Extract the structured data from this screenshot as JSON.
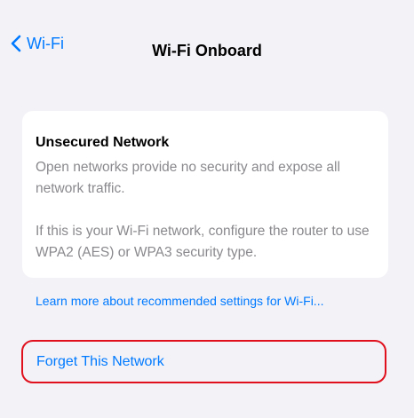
{
  "nav": {
    "back_label": "Wi-Fi",
    "title": "Wi-Fi Onboard"
  },
  "card": {
    "title": "Unsecured Network",
    "body_1": "Open networks provide no security and expose all network traffic.",
    "body_2": "If this is your Wi-Fi network, configure the router to use WPA2 (AES) or WPA3 security type."
  },
  "links": {
    "learn_more": "Learn more about recommended settings for Wi-Fi..."
  },
  "actions": {
    "forget_label": "Forget This Network"
  },
  "colors": {
    "background": "#f2f2f7",
    "accent": "#007aff",
    "highlight": "#e0101c"
  },
  "icons": {
    "back": "chevron-left-icon"
  }
}
